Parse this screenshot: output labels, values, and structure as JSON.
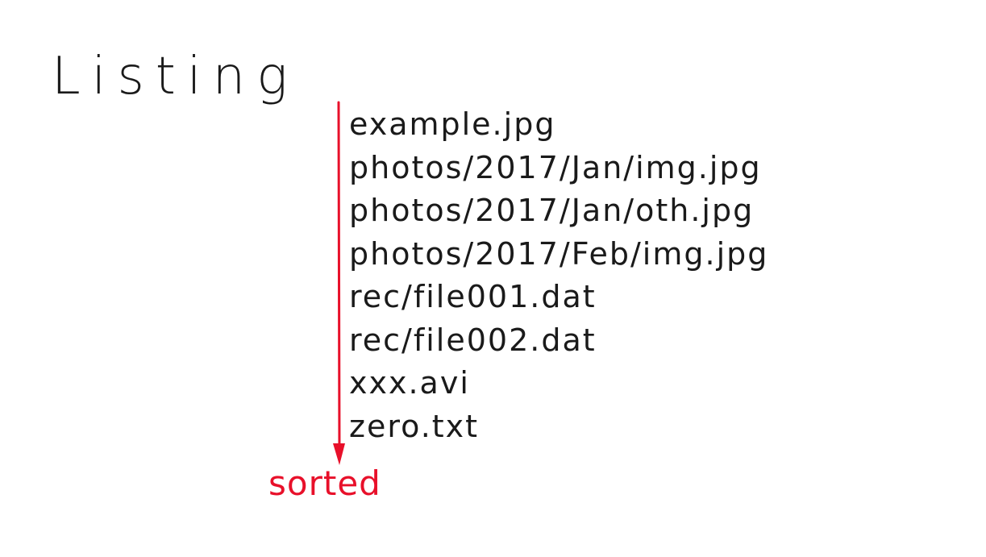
{
  "title": "Listing",
  "files": [
    "example.jpg",
    "photos/2017/Jan/img.jpg",
    "photos/2017/Jan/oth.jpg",
    "photos/2017/Feb/img.jpg",
    "rec/file001.dat",
    "rec/file002.dat",
    "xxx.avi",
    "zero.txt"
  ],
  "arrow_label": "sorted",
  "colors": {
    "ink": "#1a1a1a",
    "accent": "#e8102a"
  }
}
